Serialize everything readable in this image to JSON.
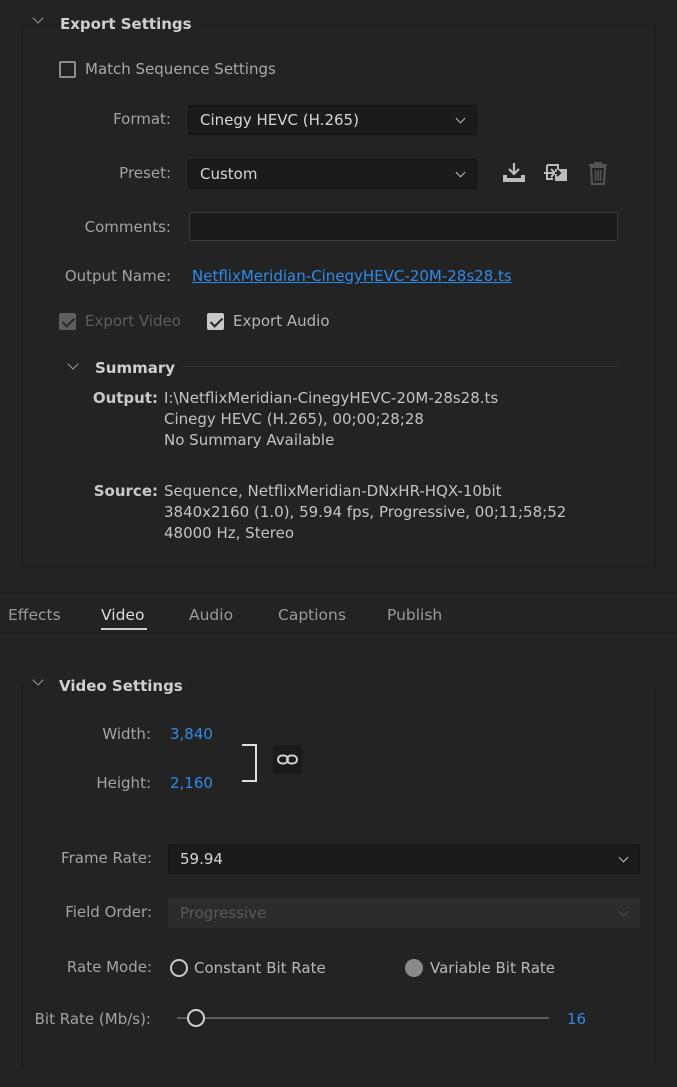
{
  "export_settings": {
    "title": "Export Settings",
    "match_sequence_label": "Match Sequence Settings",
    "format_label": "Format:",
    "format_value": "Cinegy HEVC (H.265)",
    "preset_label": "Preset:",
    "preset_value": "Custom",
    "comments_label": "Comments:",
    "comments_value": "",
    "output_name_label": "Output Name:",
    "output_name_value": "NetflixMeridian-CinegyHEVC-20M-28s28.ts",
    "export_video_label": "Export Video",
    "export_audio_label": "Export Audio",
    "export_video_checked": true,
    "export_audio_checked": true
  },
  "summary": {
    "title": "Summary",
    "output_label": "Output:",
    "output_lines": [
      "I:\\NetflixMeridian-CinegyHEVC-20M-28s28.ts",
      "Cinegy HEVC (H.265), 00;00;28;28",
      "No Summary Available"
    ],
    "source_label": "Source:",
    "source_lines": [
      "Sequence, NetflixMeridian-DNxHR-HQX-10bit",
      "3840x2160 (1.0), 59.94 fps, Progressive, 00;11;58;52",
      "48000 Hz, Stereo"
    ]
  },
  "tabs": [
    {
      "label": "Effects",
      "active": false
    },
    {
      "label": "Video",
      "active": true
    },
    {
      "label": "Audio",
      "active": false
    },
    {
      "label": "Captions",
      "active": false
    },
    {
      "label": "Publish",
      "active": false
    }
  ],
  "video_settings": {
    "title": "Video Settings",
    "width_label": "Width:",
    "width_value": "3,840",
    "height_label": "Height:",
    "height_value": "2,160",
    "frame_rate_label": "Frame Rate:",
    "frame_rate_value": "59.94",
    "field_order_label": "Field Order:",
    "field_order_value": "Progressive",
    "rate_mode_label": "Rate Mode:",
    "rate_mode_options": [
      "Constant Bit Rate",
      "Variable Bit Rate"
    ],
    "rate_mode_selected": "Constant Bit Rate",
    "bit_rate_label": "Bit Rate (Mb/s):",
    "bit_rate_value": "16",
    "bit_rate_slider_fraction": 0.05
  },
  "colors": {
    "accent": "#2d8ceb",
    "background": "#232323",
    "field_bg": "#1b1b1b"
  },
  "icons": [
    "chevron-down-icon",
    "save-preset-icon",
    "import-preset-icon",
    "delete-preset-icon",
    "link-icon"
  ]
}
